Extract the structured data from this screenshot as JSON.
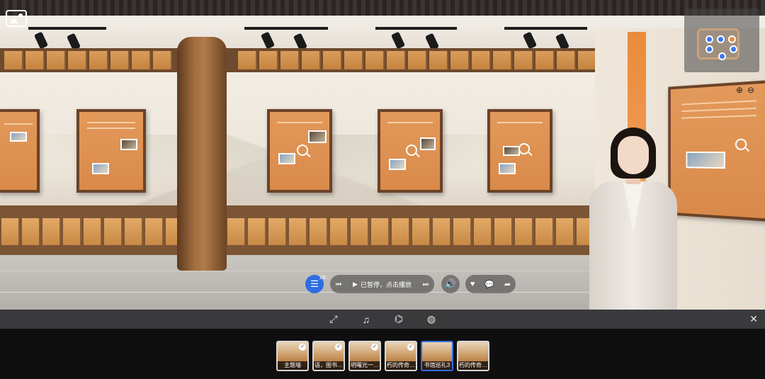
{
  "player": {
    "status_text": "已暂停，点击播放",
    "playlist_badge": "1/6"
  },
  "toolbar": {
    "icons": [
      "fullscreen-icon",
      "music-icon",
      "vr-icon",
      "gyroscope-icon"
    ],
    "close_glyph": "✕"
  },
  "scenes": [
    {
      "label": "主题墙",
      "visited": true,
      "active": false
    },
    {
      "label": "语，图书…",
      "visited": true,
      "active": false
    },
    {
      "label": "明曙光一…",
      "visited": true,
      "active": false
    },
    {
      "label": "朽的传奇…",
      "visited": true,
      "active": false
    },
    {
      "label": "书馆巡礼3",
      "visited": false,
      "active": true
    },
    {
      "label": "朽的传奇…",
      "visited": false,
      "active": false
    }
  ],
  "colors": {
    "accent": "#2f6de1",
    "poster": "#d98a4a",
    "map_current": "#ee8a3a"
  }
}
